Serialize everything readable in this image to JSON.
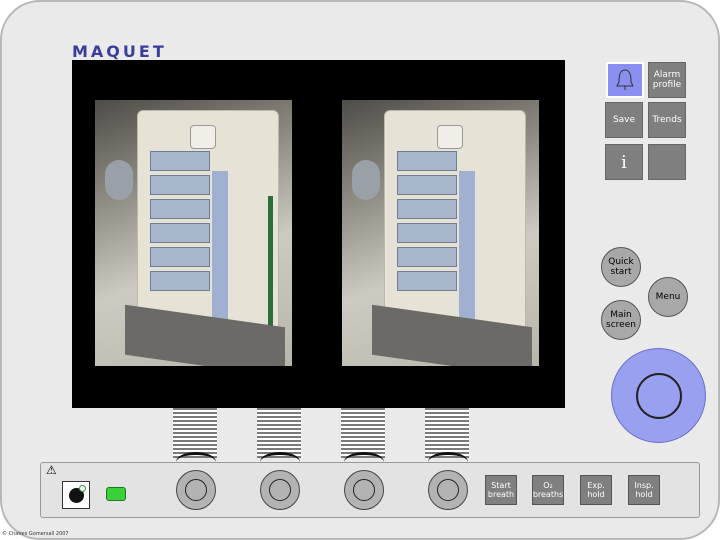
{
  "brand": "MAQUET",
  "buttons": {
    "alarm_profile": "Alarm profile",
    "save": "Save",
    "trends": "Trends",
    "info": "i",
    "quick_start": "Quick start",
    "menu": "Menu",
    "main_screen": "Main screen"
  },
  "bottom_buttons": {
    "start_breath": "Start breath",
    "o2_breaths": "O₂ breaths",
    "exp_hold": "Exp. hold",
    "insp_hold": "Insp. hold"
  },
  "warning_symbol": "⚠",
  "copyright": "© Chalres Gomersall 2007",
  "colors": {
    "dial": "#9aa0f0",
    "alarm_button": "#8a8ff0",
    "plug_indicator": "#3ad03a"
  }
}
